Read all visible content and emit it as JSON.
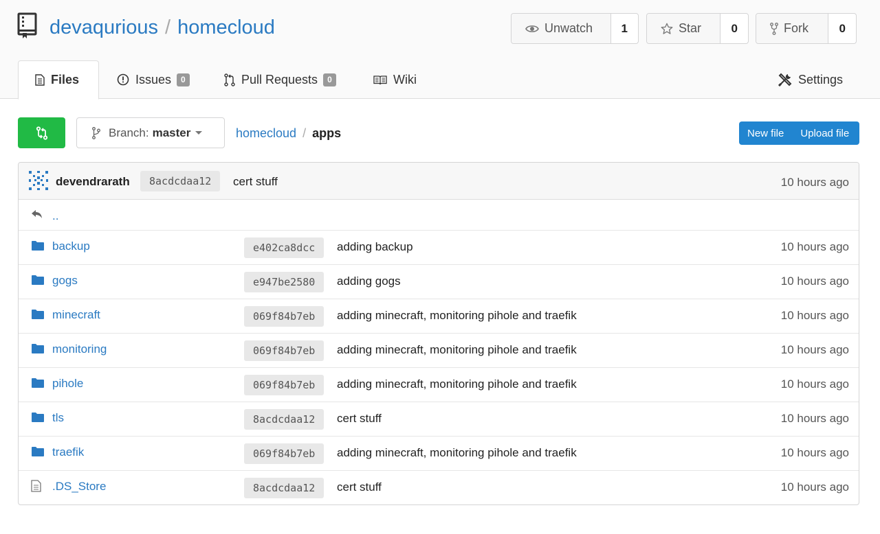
{
  "repo": {
    "owner": "devaqurious",
    "separator": "/",
    "name": "homecloud"
  },
  "actions": {
    "watch": {
      "label": "Unwatch",
      "count": "1"
    },
    "star": {
      "label": "Star",
      "count": "0"
    },
    "fork": {
      "label": "Fork",
      "count": "0"
    }
  },
  "tabs": {
    "files": {
      "label": "Files"
    },
    "issues": {
      "label": "Issues",
      "count": "0"
    },
    "pulls": {
      "label": "Pull Requests",
      "count": "0"
    },
    "wiki": {
      "label": "Wiki"
    },
    "settings": {
      "label": "Settings"
    }
  },
  "toolbar": {
    "branch_prefix": "Branch:",
    "branch": "master",
    "breadcrumb": {
      "root": "homecloud",
      "separator": "/",
      "current": "apps"
    },
    "new_file": "New file",
    "upload_file": "Upload file"
  },
  "latest_commit": {
    "author": "devendrarath",
    "sha": "8acdcdaa12",
    "message": "cert stuff",
    "age": "10 hours ago"
  },
  "parent_link": "..",
  "files": [
    {
      "type": "dir",
      "name": "backup",
      "sha": "e402ca8dcc",
      "message": "adding backup",
      "age": "10 hours ago"
    },
    {
      "type": "dir",
      "name": "gogs",
      "sha": "e947be2580",
      "message": "adding gogs",
      "age": "10 hours ago"
    },
    {
      "type": "dir",
      "name": "minecraft",
      "sha": "069f84b7eb",
      "message": "adding minecraft, monitoring pihole and traefik",
      "age": "10 hours ago"
    },
    {
      "type": "dir",
      "name": "monitoring",
      "sha": "069f84b7eb",
      "message": "adding minecraft, monitoring pihole and traefik",
      "age": "10 hours ago"
    },
    {
      "type": "dir",
      "name": "pihole",
      "sha": "069f84b7eb",
      "message": "adding minecraft, monitoring pihole and traefik",
      "age": "10 hours ago"
    },
    {
      "type": "dir",
      "name": "tls",
      "sha": "8acdcdaa12",
      "message": "cert stuff",
      "age": "10 hours ago"
    },
    {
      "type": "dir",
      "name": "traefik",
      "sha": "069f84b7eb",
      "message": "adding minecraft, monitoring pihole and traefik",
      "age": "10 hours ago"
    },
    {
      "type": "file",
      "name": ".DS_Store",
      "sha": "8acdcdaa12",
      "message": "cert stuff",
      "age": "10 hours ago"
    }
  ],
  "colors": {
    "link": "#2a7ac2",
    "green": "#21ba45",
    "blue": "#2185d0"
  },
  "icons": [
    "repo-icon",
    "eye-icon",
    "star-icon",
    "fork-icon",
    "file-text-icon",
    "issue-icon",
    "pull-request-icon",
    "book-icon",
    "tools-icon",
    "compare-icon",
    "branch-icon",
    "reply-icon",
    "folder-icon",
    "file-icon"
  ]
}
